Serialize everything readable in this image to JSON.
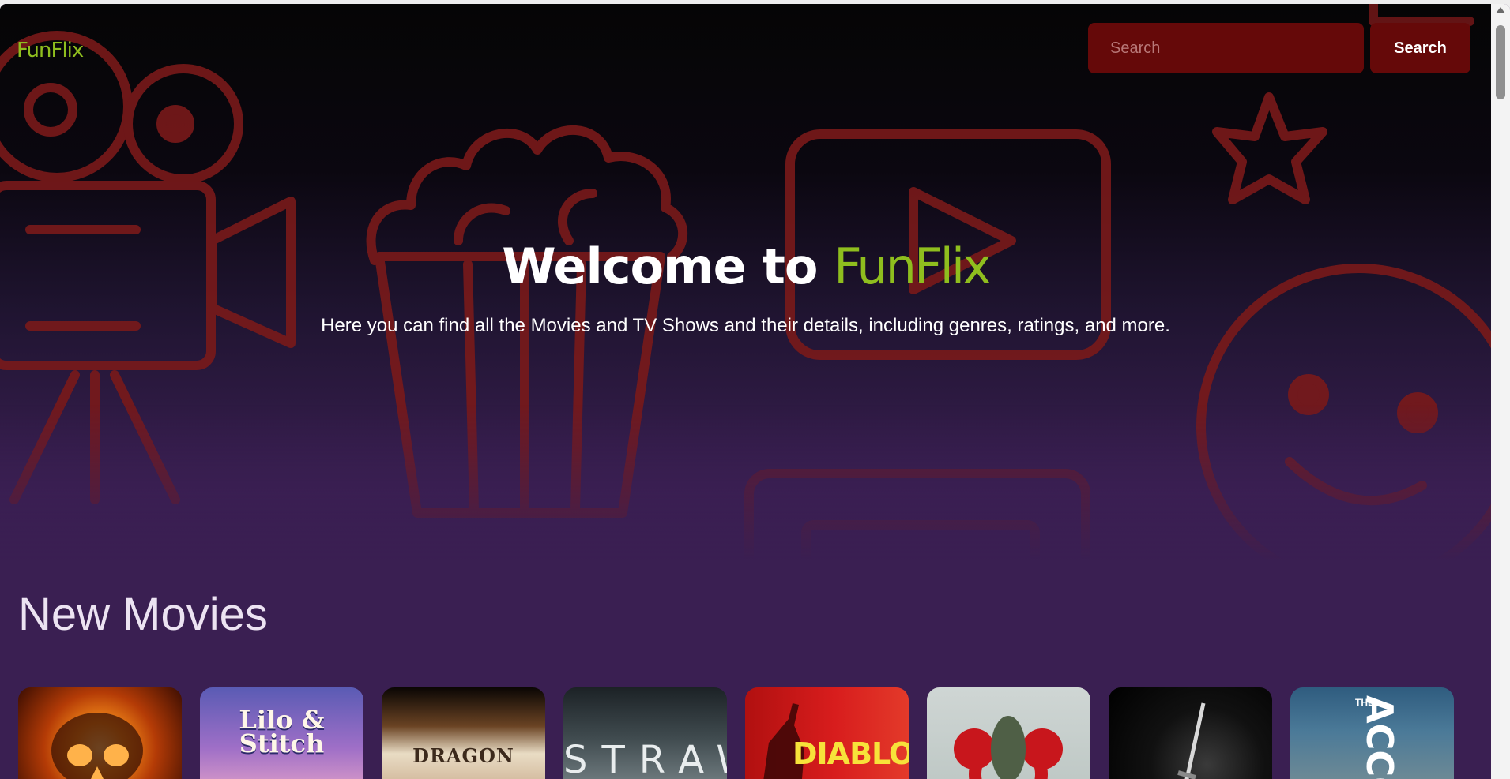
{
  "header": {
    "logo": "FunFlix",
    "search_placeholder": "Search",
    "search_button": "Search"
  },
  "hero": {
    "title_prefix": "Welcome to ",
    "title_brand": "FunFlix",
    "subtitle": "Here you can find all the Movies and TV Shows and their details, including genres, ratings, and more."
  },
  "new_movies": {
    "title": "New Movies",
    "posters": [
      {
        "text": ""
      },
      {
        "text": "Lilo & Stitch"
      },
      {
        "text": "DRAGON"
      },
      {
        "text": "STRAW"
      },
      {
        "text": "DIABLO"
      },
      {
        "text": ""
      },
      {
        "text": ""
      },
      {
        "text": "ACCO",
        "small": "THE"
      }
    ]
  },
  "colors": {
    "brand_green": "#8fbe1e",
    "search_red": "#650909",
    "section_purple": "#3a1f52",
    "outline_red": "#8a1c1c"
  },
  "icons": [
    "camera-icon",
    "popcorn-icon",
    "play-icon",
    "star-icon",
    "smiley-icon",
    "tv-icon"
  ]
}
